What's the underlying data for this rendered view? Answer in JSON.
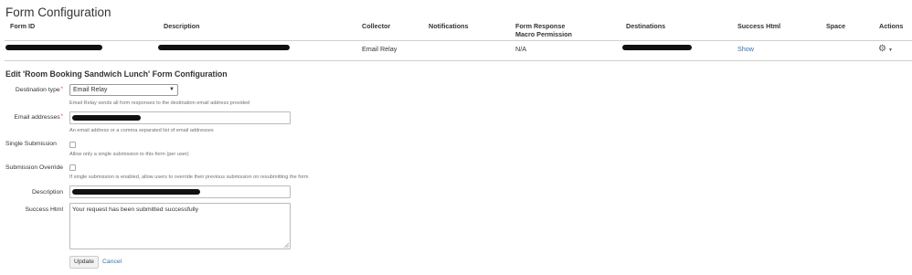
{
  "page": {
    "title": "Form Configuration"
  },
  "table": {
    "headers": [
      {
        "key": "form_id",
        "label": "Form ID"
      },
      {
        "key": "description",
        "label": "Description"
      },
      {
        "key": "collector",
        "label": "Collector"
      },
      {
        "key": "notifications",
        "label": "Notifications"
      },
      {
        "key": "form_response_1",
        "label": "Form Response"
      },
      {
        "key": "form_response_2",
        "label": "Macro Permission"
      },
      {
        "key": "destinations",
        "label": "Destinations"
      },
      {
        "key": "success_html",
        "label": "Success Html"
      },
      {
        "key": "space",
        "label": "Space"
      },
      {
        "key": "actions",
        "label": "Actions"
      }
    ],
    "row": {
      "collector": "Email Relay",
      "form_response": "N/A",
      "success_html": "Show",
      "actions_icon": "gear-icon"
    }
  },
  "edit": {
    "heading": "Edit 'Room Booking Sandwich Lunch' Form Configuration",
    "destination_type": {
      "label": "Destination type",
      "required": "*",
      "value": "Email Relay",
      "help": "Email Relay sends all form responses to the destination email address provided"
    },
    "email_addresses": {
      "label": "Email addresses",
      "required": "*",
      "help": "An email address or a comma separated list of email addresses"
    },
    "single_submission": {
      "label": "Single Submission",
      "checked": false,
      "help": "Allow only a single submission to this form (per user)"
    },
    "submission_override": {
      "label": "Submission Override",
      "checked": false,
      "help": "If single submission is enabled, allow users to override their previous submission on resubmitting the form"
    },
    "description": {
      "label": "Description"
    },
    "success_html": {
      "label": "Success Html",
      "value": "Your request has been submitted successfully"
    },
    "update_label": "Update",
    "cancel_label": "Cancel"
  }
}
